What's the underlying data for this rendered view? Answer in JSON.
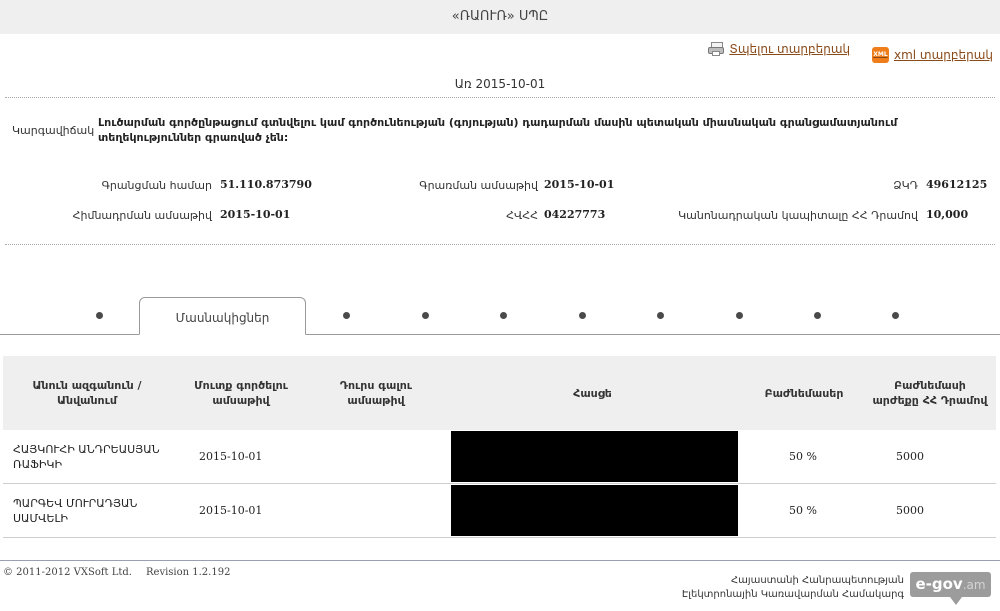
{
  "header": {
    "title": "«ՌԱՈՒՌ» ՍՊԸ"
  },
  "exports": {
    "print_label": "Տպելու տարբերակ",
    "xml_label": "xml տարբերակ",
    "xml_icon_text": "XML"
  },
  "date_line": "Առ 2015-10-01",
  "status": {
    "label": "Կարգավիճակ",
    "text": "Լուծարման գործընթացում գտնվելու կամ գործունեության (գոյության) դադարման մասին պետական միասնական գրանցամատյանում տեղեկություններ գրառված չեն:"
  },
  "fields": {
    "reg_number_label": "Գրանցման համար",
    "reg_number_value": "51.110.873790",
    "record_date_label": "Գրառման ամսաթիվ",
    "record_date_value": "2015-10-01",
    "tin_label": "ՀՎՀՀ",
    "tin_value": "04227773",
    "zkd_label": "ՁԿԴ",
    "zkd_value": "49612125",
    "founding_date_label": "Հիմնադրման ամսաթիվ",
    "founding_date_value": "2015-10-01",
    "capital_label": "Կանոնադրական կապիտալը ՀՀ Դրամով",
    "capital_value": "10,000"
  },
  "tabs": {
    "active_label": "Մասնակիցներ"
  },
  "members_table": {
    "headers": [
      "Անուն ազգանուն / Անվանում",
      "Մուտք գործելու ամսաթիվ",
      "Դուրս գալու ամսաթիվ",
      "Հասցե",
      "Բաժնեմասեր",
      "Բաժնեմասի արժեքը ՀՀ Դրամով"
    ],
    "rows": [
      {
        "name": "ՀԱՅԿՈՒՀԻ ԱՆԴՐԵԱՍՅԱՆ ՌԱՖԻԿԻ",
        "entry_date": "2015-10-01",
        "exit_date": "",
        "share": "50 %",
        "value": "5000"
      },
      {
        "name": "ՊԱՐԳԵՎ ՄՈՒՐԱԴՅԱՆ ՍԱՄՎԵԼԻ",
        "entry_date": "2015-10-01",
        "exit_date": "",
        "share": "50 %",
        "value": "5000"
      }
    ]
  },
  "footer": {
    "copyright": "© 2011-2012 VXSoft Ltd.",
    "revision": "Revision 1.2.192",
    "agency_line1": "Հայաստանի Հանրապետության",
    "agency_line2": "Էլեկտրոնային Կառավարման Համակարգ",
    "logo_main": "e-gov",
    "logo_suffix": ".am"
  }
}
